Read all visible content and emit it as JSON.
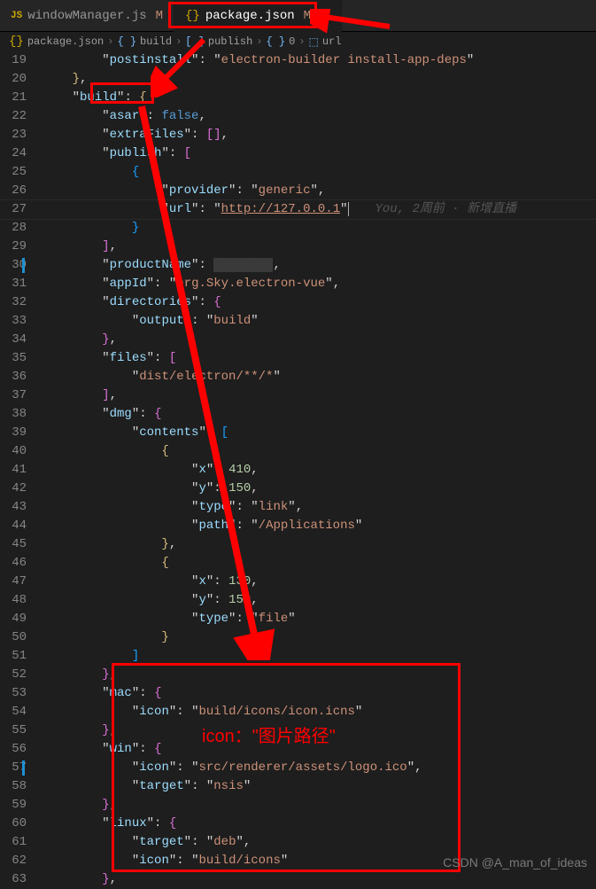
{
  "tabs": [
    {
      "icon": "JS",
      "label": "windowManager.js",
      "modified": "M"
    },
    {
      "icon": "{}",
      "label": "package.json",
      "modified": "M",
      "close": "×"
    }
  ],
  "breadcrumbs": {
    "file_icon": "{}",
    "file": "package.json",
    "sep": "›",
    "seg1_icon": "{ }",
    "seg1": "build",
    "seg2_icon": "[ ]",
    "seg2": "publish",
    "seg3_icon": "{ }",
    "seg3": "0",
    "seg4_icon": "⬚",
    "seg4": "url"
  },
  "line_start": 19,
  "line_end": 63,
  "mod_lines": [
    30,
    57
  ],
  "blame": "You, 2周前 · 新增直播",
  "code": {
    "l19": {
      "key": "postinstall",
      "val": "electron-builder install-app-deps"
    },
    "l21": {
      "key": "build"
    },
    "l22": {
      "key": "asar",
      "val": "false"
    },
    "l23": {
      "key": "extraFiles"
    },
    "l24": {
      "key": "publish"
    },
    "l26": {
      "key": "provider",
      "val": "generic"
    },
    "l27": {
      "key": "url",
      "val": "http://127.0.0.1"
    },
    "l30": {
      "key": "productName"
    },
    "l31": {
      "key": "appId",
      "val": "org.Sky.electron-vue"
    },
    "l32": {
      "key": "directories"
    },
    "l33": {
      "key": "output",
      "val": "build"
    },
    "l35": {
      "key": "files"
    },
    "l36": {
      "val": "dist/electron/**/*"
    },
    "l38": {
      "key": "dmg"
    },
    "l39": {
      "key": "contents"
    },
    "l41": {
      "key": "x",
      "val": "410"
    },
    "l42": {
      "key": "y",
      "val": "150"
    },
    "l43": {
      "key": "type",
      "val": "link"
    },
    "l44": {
      "key": "path",
      "val": "/Applications"
    },
    "l47": {
      "key": "x",
      "val": "130"
    },
    "l48": {
      "key": "y",
      "val": "150"
    },
    "l49": {
      "key": "type",
      "val": "file"
    },
    "l53": {
      "key": "mac"
    },
    "l54": {
      "key": "icon",
      "val": "build/icons/icon.icns"
    },
    "l56": {
      "key": "win"
    },
    "l57": {
      "key": "icon",
      "val": "src/renderer/assets/logo.ico"
    },
    "l58": {
      "key": "target",
      "val": "nsis"
    },
    "l60": {
      "key": "linux"
    },
    "l61": {
      "key": "target",
      "val": "deb"
    },
    "l62": {
      "key": "icon",
      "val": "build/icons"
    }
  },
  "annotation_text": "icon：\"图片路径\"",
  "watermark": "CSDN @A_man_of_ideas"
}
